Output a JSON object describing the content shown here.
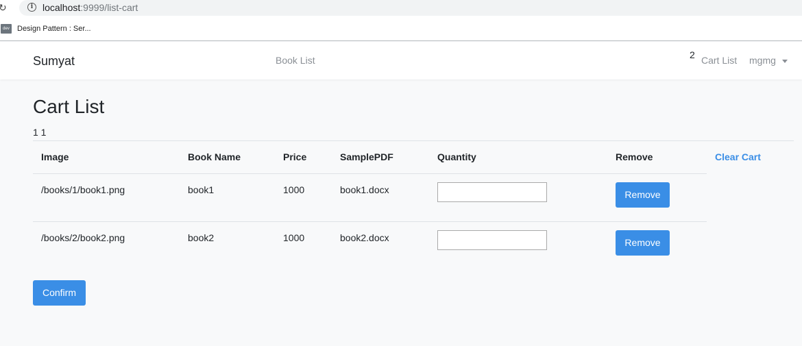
{
  "browser": {
    "url_host": "localhost",
    "url_path": ":9999/list-cart",
    "bookmark_icon_text": "dev",
    "bookmark_label": "Design Pattern : Ser..."
  },
  "navbar": {
    "brand": "Sumyat",
    "book_list": "Book List",
    "cart_count": "2",
    "cart_list": "Cart List",
    "user": "mgmg"
  },
  "page": {
    "title": "Cart List",
    "counts": "1 1"
  },
  "table": {
    "headers": [
      "Image",
      "Book Name",
      "Price",
      "SamplePDF",
      "Quantity",
      "Remove"
    ],
    "clear_cart": "Clear Cart",
    "rows": [
      {
        "image": "/books/1/book1.png",
        "name": "book1",
        "price": "1000",
        "pdf": "book1.docx",
        "quantity": "",
        "remove_label": "Remove"
      },
      {
        "image": "/books/2/book2.png",
        "name": "book2",
        "price": "1000",
        "pdf": "book2.docx",
        "quantity": "",
        "remove_label": "Remove"
      }
    ]
  },
  "confirm_label": "Confirm",
  "colors": {
    "accent": "#3a8ee6",
    "page_bg": "#f8f9fa"
  }
}
